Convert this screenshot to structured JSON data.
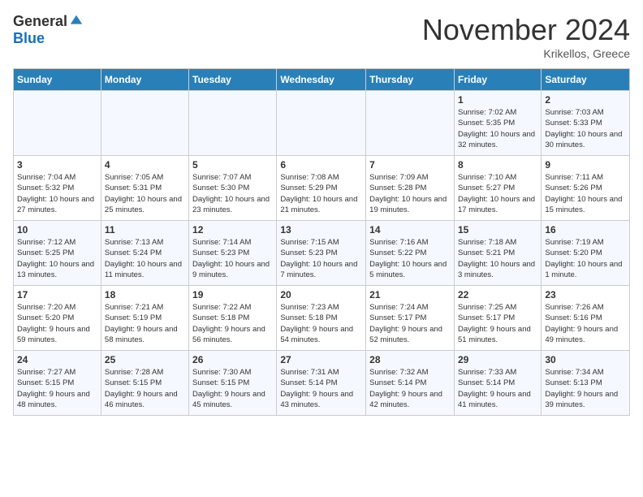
{
  "header": {
    "logo_general": "General",
    "logo_blue": "Blue",
    "month": "November 2024",
    "location": "Krikellos, Greece"
  },
  "days_of_week": [
    "Sunday",
    "Monday",
    "Tuesday",
    "Wednesday",
    "Thursday",
    "Friday",
    "Saturday"
  ],
  "weeks": [
    [
      {
        "day": "",
        "info": ""
      },
      {
        "day": "",
        "info": ""
      },
      {
        "day": "",
        "info": ""
      },
      {
        "day": "",
        "info": ""
      },
      {
        "day": "",
        "info": ""
      },
      {
        "day": "1",
        "info": "Sunrise: 7:02 AM\nSunset: 5:35 PM\nDaylight: 10 hours and 32 minutes."
      },
      {
        "day": "2",
        "info": "Sunrise: 7:03 AM\nSunset: 5:33 PM\nDaylight: 10 hours and 30 minutes."
      }
    ],
    [
      {
        "day": "3",
        "info": "Sunrise: 7:04 AM\nSunset: 5:32 PM\nDaylight: 10 hours and 27 minutes."
      },
      {
        "day": "4",
        "info": "Sunrise: 7:05 AM\nSunset: 5:31 PM\nDaylight: 10 hours and 25 minutes."
      },
      {
        "day": "5",
        "info": "Sunrise: 7:07 AM\nSunset: 5:30 PM\nDaylight: 10 hours and 23 minutes."
      },
      {
        "day": "6",
        "info": "Sunrise: 7:08 AM\nSunset: 5:29 PM\nDaylight: 10 hours and 21 minutes."
      },
      {
        "day": "7",
        "info": "Sunrise: 7:09 AM\nSunset: 5:28 PM\nDaylight: 10 hours and 19 minutes."
      },
      {
        "day": "8",
        "info": "Sunrise: 7:10 AM\nSunset: 5:27 PM\nDaylight: 10 hours and 17 minutes."
      },
      {
        "day": "9",
        "info": "Sunrise: 7:11 AM\nSunset: 5:26 PM\nDaylight: 10 hours and 15 minutes."
      }
    ],
    [
      {
        "day": "10",
        "info": "Sunrise: 7:12 AM\nSunset: 5:25 PM\nDaylight: 10 hours and 13 minutes."
      },
      {
        "day": "11",
        "info": "Sunrise: 7:13 AM\nSunset: 5:24 PM\nDaylight: 10 hours and 11 minutes."
      },
      {
        "day": "12",
        "info": "Sunrise: 7:14 AM\nSunset: 5:23 PM\nDaylight: 10 hours and 9 minutes."
      },
      {
        "day": "13",
        "info": "Sunrise: 7:15 AM\nSunset: 5:23 PM\nDaylight: 10 hours and 7 minutes."
      },
      {
        "day": "14",
        "info": "Sunrise: 7:16 AM\nSunset: 5:22 PM\nDaylight: 10 hours and 5 minutes."
      },
      {
        "day": "15",
        "info": "Sunrise: 7:18 AM\nSunset: 5:21 PM\nDaylight: 10 hours and 3 minutes."
      },
      {
        "day": "16",
        "info": "Sunrise: 7:19 AM\nSunset: 5:20 PM\nDaylight: 10 hours and 1 minute."
      }
    ],
    [
      {
        "day": "17",
        "info": "Sunrise: 7:20 AM\nSunset: 5:20 PM\nDaylight: 9 hours and 59 minutes."
      },
      {
        "day": "18",
        "info": "Sunrise: 7:21 AM\nSunset: 5:19 PM\nDaylight: 9 hours and 58 minutes."
      },
      {
        "day": "19",
        "info": "Sunrise: 7:22 AM\nSunset: 5:18 PM\nDaylight: 9 hours and 56 minutes."
      },
      {
        "day": "20",
        "info": "Sunrise: 7:23 AM\nSunset: 5:18 PM\nDaylight: 9 hours and 54 minutes."
      },
      {
        "day": "21",
        "info": "Sunrise: 7:24 AM\nSunset: 5:17 PM\nDaylight: 9 hours and 52 minutes."
      },
      {
        "day": "22",
        "info": "Sunrise: 7:25 AM\nSunset: 5:17 PM\nDaylight: 9 hours and 51 minutes."
      },
      {
        "day": "23",
        "info": "Sunrise: 7:26 AM\nSunset: 5:16 PM\nDaylight: 9 hours and 49 minutes."
      }
    ],
    [
      {
        "day": "24",
        "info": "Sunrise: 7:27 AM\nSunset: 5:15 PM\nDaylight: 9 hours and 48 minutes."
      },
      {
        "day": "25",
        "info": "Sunrise: 7:28 AM\nSunset: 5:15 PM\nDaylight: 9 hours and 46 minutes."
      },
      {
        "day": "26",
        "info": "Sunrise: 7:30 AM\nSunset: 5:15 PM\nDaylight: 9 hours and 45 minutes."
      },
      {
        "day": "27",
        "info": "Sunrise: 7:31 AM\nSunset: 5:14 PM\nDaylight: 9 hours and 43 minutes."
      },
      {
        "day": "28",
        "info": "Sunrise: 7:32 AM\nSunset: 5:14 PM\nDaylight: 9 hours and 42 minutes."
      },
      {
        "day": "29",
        "info": "Sunrise: 7:33 AM\nSunset: 5:14 PM\nDaylight: 9 hours and 41 minutes."
      },
      {
        "day": "30",
        "info": "Sunrise: 7:34 AM\nSunset: 5:13 PM\nDaylight: 9 hours and 39 minutes."
      }
    ]
  ]
}
